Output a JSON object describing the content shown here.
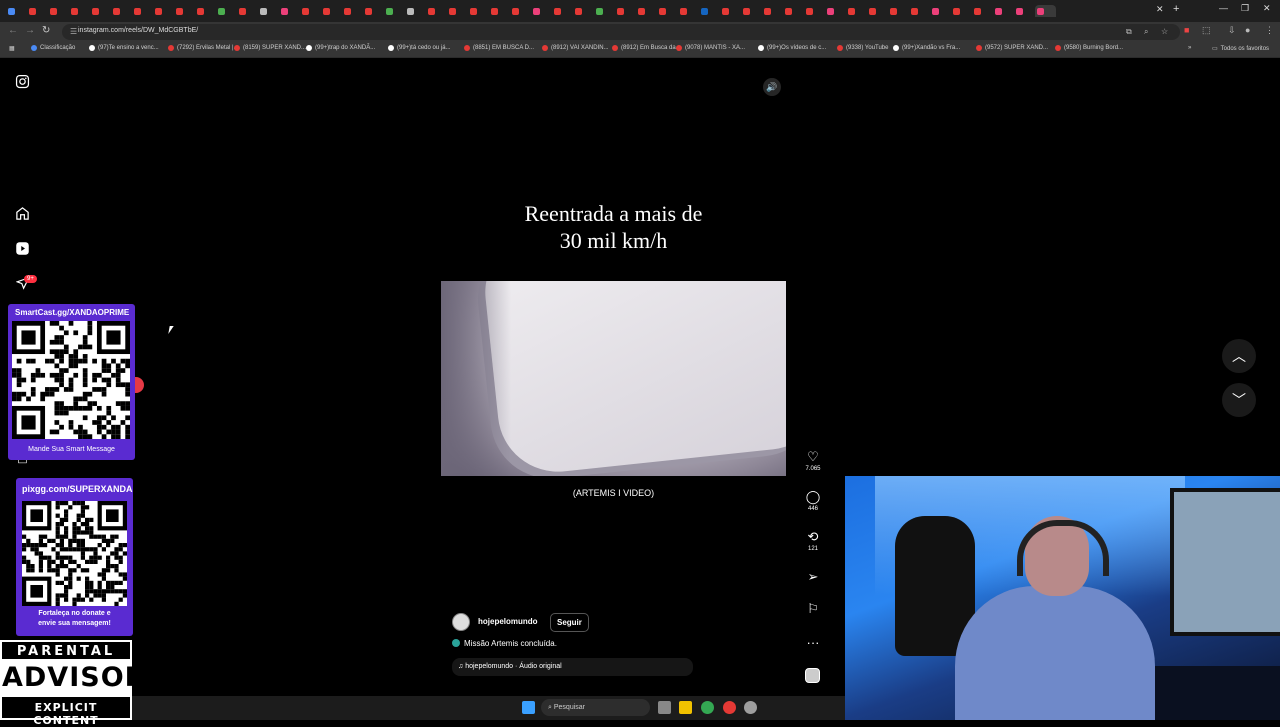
{
  "browser": {
    "tab_favicon_colors": [
      "#4a8af4",
      "#e53935",
      "#e53935",
      "#e53935",
      "#e53935",
      "#e53935",
      "#e53935",
      "#e53935",
      "#e53935",
      "#e53935",
      "#4caf50",
      "#e53935",
      "#bbbbbb",
      "#ec407a",
      "#e53935",
      "#e53935",
      "#e53935",
      "#e53935",
      "#4caf50",
      "#bbbbbb",
      "#e53935",
      "#e53935",
      "#e53935",
      "#e53935",
      "#e53935",
      "#ec407a",
      "#e53935",
      "#e53935",
      "#4caf50",
      "#e53935",
      "#e53935",
      "#e53935",
      "#e53935",
      "#1565c0",
      "#e53935",
      "#e53935",
      "#e53935",
      "#e53935",
      "#e53935",
      "#ec407a",
      "#e53935",
      "#e53935",
      "#e53935",
      "#e53935",
      "#ec407a",
      "#e53935",
      "#e53935",
      "#ec407a",
      "#ec407a",
      "#ec407a"
    ],
    "tab_close": "✕",
    "new_tab": "+",
    "window_controls": {
      "minimize": "—",
      "restore": "❐",
      "close": "✕"
    },
    "url": "instagram.com/reels/DW_MdCGBTbE/",
    "bookmarks": [
      {
        "label": "Classificação",
        "color": "#4a8af4"
      },
      {
        "label": "(97)Te ensino a venc...",
        "color": "#ffffff"
      },
      {
        "label": "(7292) Ervilas Metal |...",
        "color": "#e53935"
      },
      {
        "label": "(8159) SUPER XAND...",
        "color": "#e53935"
      },
      {
        "label": "(99+)trap do XANDÃ...",
        "color": "#ffffff"
      },
      {
        "label": "(99+)tá cedo ou já...",
        "color": "#ffffff"
      },
      {
        "label": "(8851) EM BUSCA D...",
        "color": "#e53935"
      },
      {
        "label": "(8912) VAI XANDIN...",
        "color": "#e53935"
      },
      {
        "label": "(8912) Em Busca da...",
        "color": "#e53935"
      },
      {
        "label": "(9078) MANTIS - XA...",
        "color": "#e53935"
      },
      {
        "label": "(99+)Os vídeos de c...",
        "color": "#ffffff"
      },
      {
        "label": "(9338) YouTube",
        "color": "#e53935"
      },
      {
        "label": "(99+)Xandão vs Fra...",
        "color": "#ffffff"
      },
      {
        "label": "(9572) SUPER XAND...",
        "color": "#e53935"
      },
      {
        "label": "(9580) Burning Bord...",
        "color": "#e53935"
      }
    ],
    "all_bookmarks": "Todos os favoritos"
  },
  "instagram": {
    "notification_count": "9+"
  },
  "overlays": {
    "smartcast_title": "SmartCast.gg/XANDAOPRIME",
    "smartcast_footer": "Mande Sua Smart Message",
    "pix_title": "pixgg.com/SUPERXANDA",
    "pix_footer_1": "Fortaleça no donate e",
    "pix_footer_2": "envie sua mensagem!",
    "advisory_top": "PARENTAL",
    "advisory_mid": "ADVISORY",
    "advisory_bot": "EXPLICIT CONTENT"
  },
  "reel": {
    "title_line1": "Reentrada a mais de",
    "title_line2": "30 mil km/h",
    "video_caption": "(ARTEMIS I VIDEO)",
    "author": "hojepelomundo",
    "follow": "Seguir",
    "description": "Missão Artemis concluída.",
    "audio": "hojepelomundo · Áudio original",
    "likes": "7.065",
    "comments": "446",
    "reposts": "121"
  },
  "taskbar": {
    "search_placeholder": "Pesquisar"
  }
}
